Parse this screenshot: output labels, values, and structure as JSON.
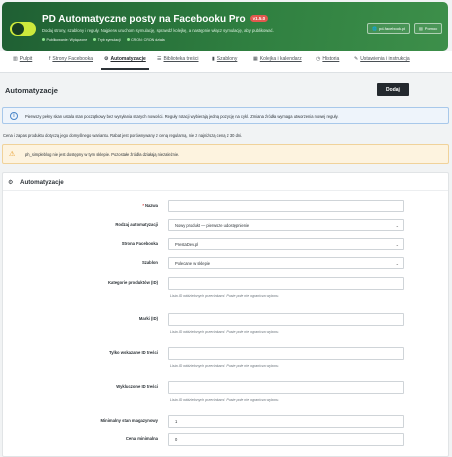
{
  "header": {
    "title": "PD Automatyczne posty na Facebooku Pro",
    "version": "v1.5.0",
    "subtitle": "Dodaj strony, szablony i reguły. Najpierw uruchom symulację, sprawdź kolejkę, a następnie włącz symulację, aby publikować.",
    "status": [
      {
        "label": "Publikowanie: Wyłączone"
      },
      {
        "label": "Tryb symulacji"
      },
      {
        "label": "CRON: CRON działa"
      }
    ],
    "buttons": [
      {
        "label": "pd-facebook.pl"
      },
      {
        "label": "Pomoc"
      }
    ],
    "colors": {
      "accent": "#2f7f40",
      "version_badge": "#e2584e"
    }
  },
  "tabs": [
    {
      "label": "Pulpit",
      "icon": "chart-icon"
    },
    {
      "label": "Strony Facebooka",
      "icon": "facebook-icon"
    },
    {
      "label": "Automatyzacje",
      "icon": "cogs-icon",
      "active": true
    },
    {
      "label": "Biblioteka treści",
      "icon": "list-icon"
    },
    {
      "label": "Szablony",
      "icon": "file-icon"
    },
    {
      "label": "Kolejka i kalendarz",
      "icon": "calendar-icon"
    },
    {
      "label": "Historia",
      "icon": "history-icon"
    },
    {
      "label": "Ustawienia i instrukcja",
      "icon": "wrench-icon"
    }
  ],
  "page": {
    "title": "Automatyzacje",
    "add_button": "Dodaj"
  },
  "alerts": {
    "info": "Pierwszy pełny skan ustala stan początkowy bez wysyłania starych nowości. Reguły rotacji wybierają jedną pozycję na cykl. Zmiana źródła wymaga utworzenia nowej reguły.",
    "note": "Cena i zapas produktu dotyczą jego domyślnego wariantu. Rabat jest porównywany z ceną regularną, nie z najniższą ceną z 30 dni.",
    "warning": "ph_simpleblog nie jest dostępny w tym sklepie. Pozostałe źródła działają niezależnie."
  },
  "form": {
    "title": "Automatyzacje",
    "name": {
      "label": "Nazwa",
      "value": ""
    },
    "type": {
      "label": "Rodzaj automatyzacji",
      "value": "Nowy produkt — pierwsze udostępnienie"
    },
    "page": {
      "label": "Strona Facebooka",
      "value": "PrestaDev.pl"
    },
    "template": {
      "label": "Szablon",
      "value": "Polecane w sklepie"
    },
    "categories": {
      "label": "Kategorie produktów (ID)",
      "value": "",
      "hint": "Lista ID oddzielonych przecinkami. Puste pole nie ogranicza wyboru."
    },
    "brands": {
      "label": "Marki (ID)",
      "value": "",
      "hint": "Lista ID oddzielonych przecinkami. Puste pole nie ogranicza wyboru."
    },
    "only_ids": {
      "label": "Tylko wskazane ID treści",
      "value": "",
      "hint": "Lista ID oddzielonych przecinkami. Puste pole nie ogranicza wyboru."
    },
    "excluded_ids": {
      "label": "Wykluczone ID treści",
      "value": "",
      "hint": "Lista ID oddzielonych przecinkami. Puste pole nie ogranicza wyboru."
    },
    "min_stock": {
      "label": "Minimalny stan magazynowy",
      "value": "1"
    },
    "min_price": {
      "label": "Cena minimalna",
      "value": "0"
    }
  }
}
